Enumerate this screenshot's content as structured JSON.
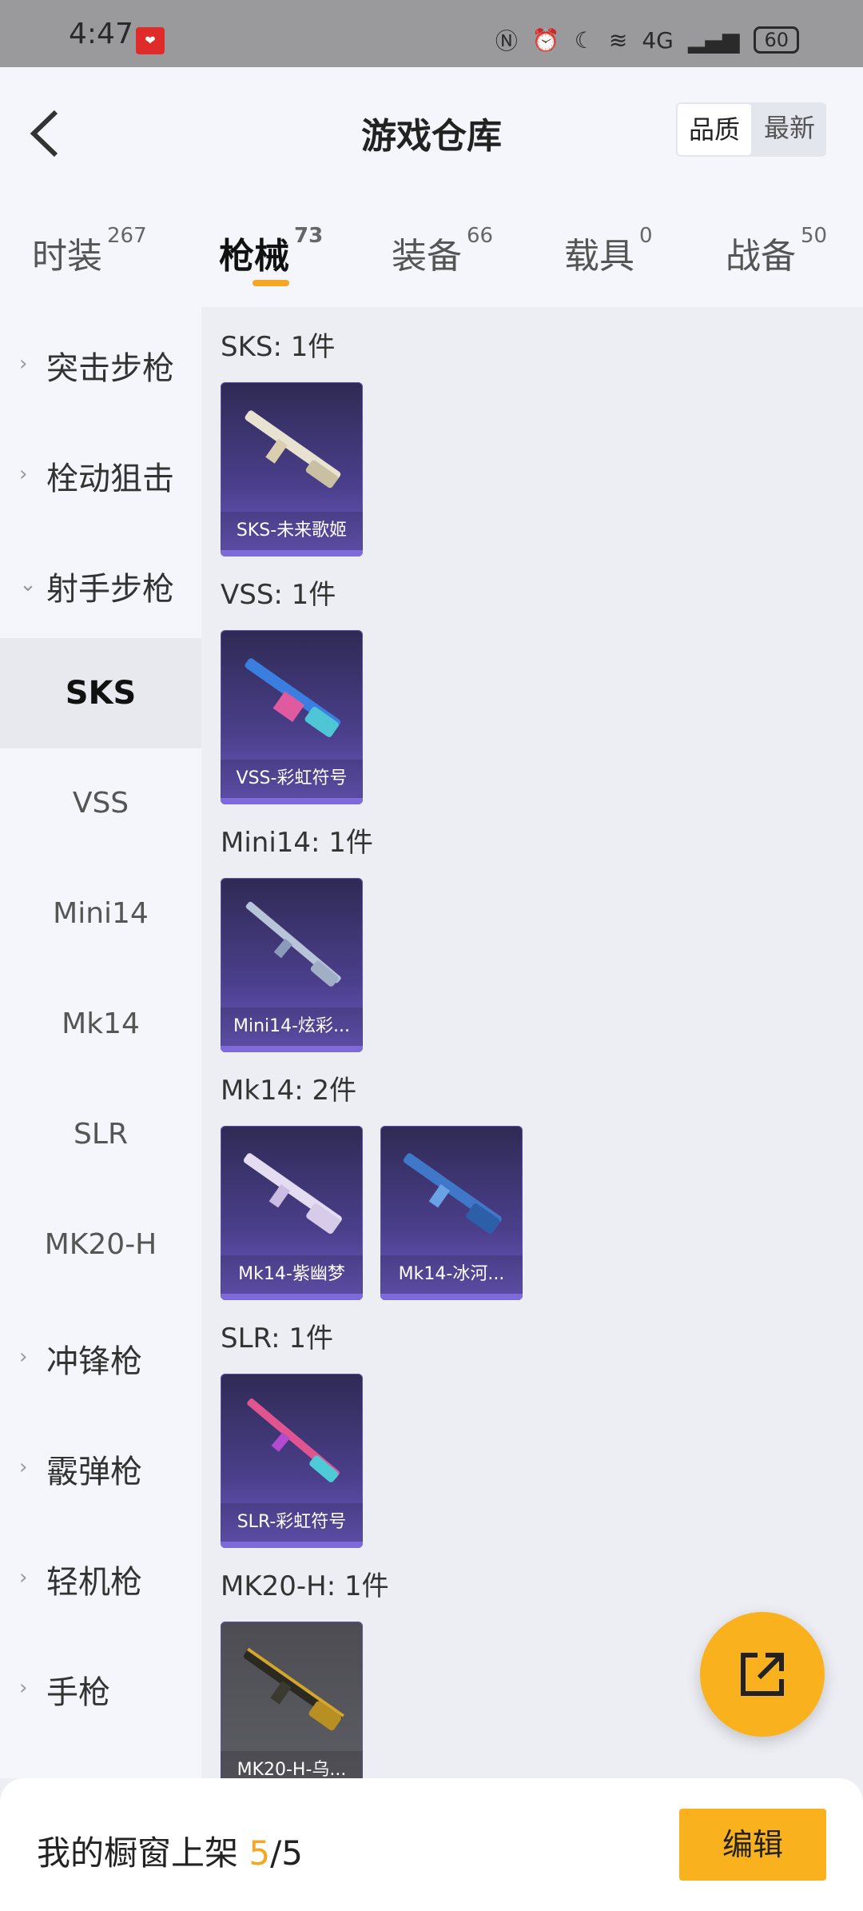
{
  "status": {
    "time": "4:47",
    "battery": "60",
    "network": "4G"
  },
  "header": {
    "title": "游戏仓库",
    "sort_quality": "品质",
    "sort_latest": "最新"
  },
  "tabs": [
    {
      "label": "时装",
      "count": "267"
    },
    {
      "label": "枪械",
      "count": "73"
    },
    {
      "label": "装备",
      "count": "66"
    },
    {
      "label": "载具",
      "count": "0"
    },
    {
      "label": "战备",
      "count": "50"
    }
  ],
  "sidebar": {
    "categories_top": [
      {
        "label": "突击步枪"
      },
      {
        "label": "栓动狙击"
      },
      {
        "label": "射手步枪"
      }
    ],
    "subitems": [
      {
        "label": "SKS"
      },
      {
        "label": "VSS"
      },
      {
        "label": "Mini14"
      },
      {
        "label": "Mk14"
      },
      {
        "label": "SLR"
      },
      {
        "label": "MK20-H"
      }
    ],
    "categories_bottom": [
      {
        "label": "冲锋枪"
      },
      {
        "label": "霰弹枪"
      },
      {
        "label": "轻机枪"
      },
      {
        "label": "手枪"
      }
    ]
  },
  "sections": [
    {
      "title": "SKS: 1件",
      "items": [
        {
          "name": "SKS-未来歌姬"
        }
      ]
    },
    {
      "title": "VSS: 1件",
      "items": [
        {
          "name": "VSS-彩虹符号"
        }
      ]
    },
    {
      "title": "Mini14: 1件",
      "items": [
        {
          "name": "Mini14-炫彩..."
        }
      ]
    },
    {
      "title": "Mk14: 2件",
      "items": [
        {
          "name": "Mk14-紫幽梦"
        },
        {
          "name": "Mk14-冰河..."
        }
      ]
    },
    {
      "title": "SLR: 1件",
      "items": [
        {
          "name": "SLR-彩虹符号"
        }
      ]
    },
    {
      "title": "MK20-H: 1件",
      "items": [
        {
          "name": "MK20-H-乌..."
        }
      ]
    }
  ],
  "footer": {
    "label": "我的橱窗上架",
    "current": "5",
    "total": "/5",
    "edit_label": "编辑"
  },
  "colors": {
    "accent": "#f9b21d",
    "card_purple": "#4b3f8c"
  },
  "icons": {
    "back": "chevron-left-icon",
    "share": "share-external-icon"
  }
}
